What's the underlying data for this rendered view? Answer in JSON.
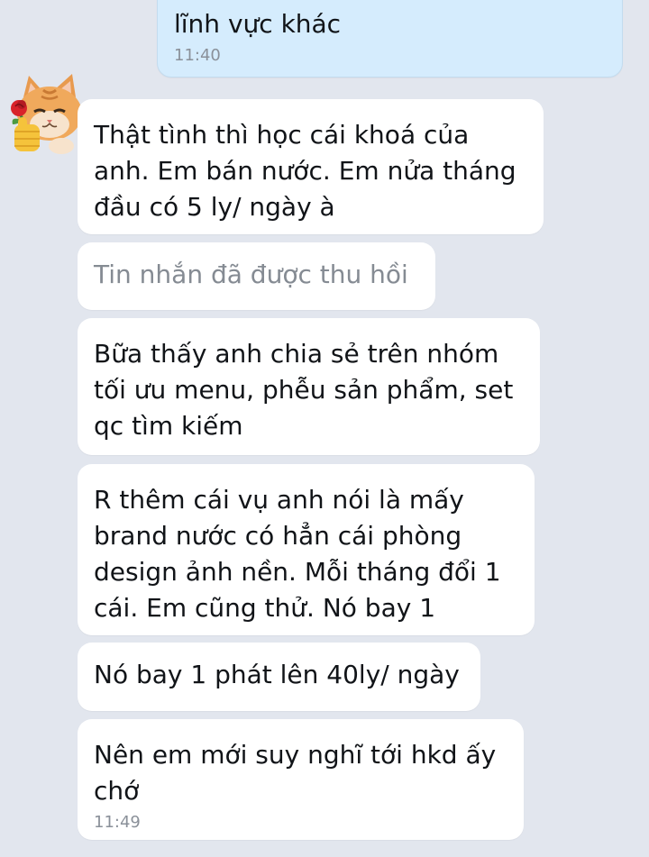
{
  "sent_message": {
    "text": "lĩnh vực khác",
    "time": "11:40"
  },
  "messages": [
    {
      "text": "Thật tình thì học cái khoá của\nanh. Em bán nước. Em nửa tháng\nđầu có 5 ly/ ngày à"
    },
    {
      "text": "Tin nhắn đã được thu hồi",
      "recalled": true
    },
    {
      "text": "Bữa thấy anh chia sẻ trên nhóm\ntối ưu menu, phễu sản phẩm, set\nqc tìm kiếm"
    },
    {
      "text": "R thêm cái vụ anh nói là mấy\nbrand nước có hẳn cái phòng\ndesign ảnh nền. Mỗi tháng đổi 1\ncái. Em cũng thử. Nó bay 1"
    },
    {
      "text": "Nó bay 1 phát lên 40ly/ ngày"
    },
    {
      "text": "Nên em mới suy nghĩ tới hkd ấy\nchớ",
      "time": "11:49"
    }
  ],
  "avatar": {
    "icon": "cat-sticker-avatar-icon"
  },
  "colors": {
    "background": "#e2e6ee",
    "incoming_bubble": "#ffffff",
    "outgoing_bubble": "#d5ecfd",
    "timestamp": "#8a9099",
    "recalled_text": "#858b93"
  }
}
